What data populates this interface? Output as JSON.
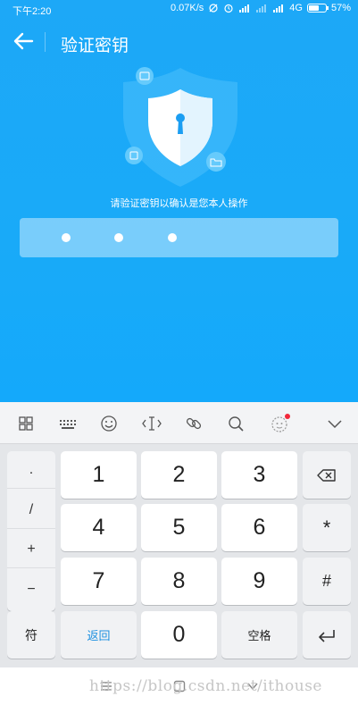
{
  "status_bar": {
    "time": "下午2:20",
    "network_speed": "0.07K/s",
    "network_type": "4G",
    "battery_percent": "57%",
    "battery_level": 0.57
  },
  "header": {
    "title": "验证密钥",
    "back_icon": "arrow-left-icon"
  },
  "main": {
    "hint": "请验证密钥以确认是您本人操作",
    "password_dots_entered": 3
  },
  "keyboard": {
    "toolbar_icons": [
      "grid-icon",
      "keyboard-icon",
      "emoji-icon",
      "cursor-icon",
      "link-icon",
      "search-icon",
      "avatar-icon",
      "chevron-down-icon"
    ],
    "symbols": [
      ".",
      "/",
      "+",
      "−"
    ],
    "digits": {
      "k1": "1",
      "k2": "2",
      "k3": "3",
      "k4": "4",
      "k5": "5",
      "k6": "6",
      "k7": "7",
      "k8": "8",
      "k9": "9",
      "k0": "0"
    },
    "star": "*",
    "hash": "#",
    "symbol_key": "符",
    "return_key": "返回",
    "space_key": "空格",
    "return_color": "#1a8fe0",
    "accent": "#19aaf8"
  },
  "watermark": "https://blog.csdn.net/ithouse"
}
